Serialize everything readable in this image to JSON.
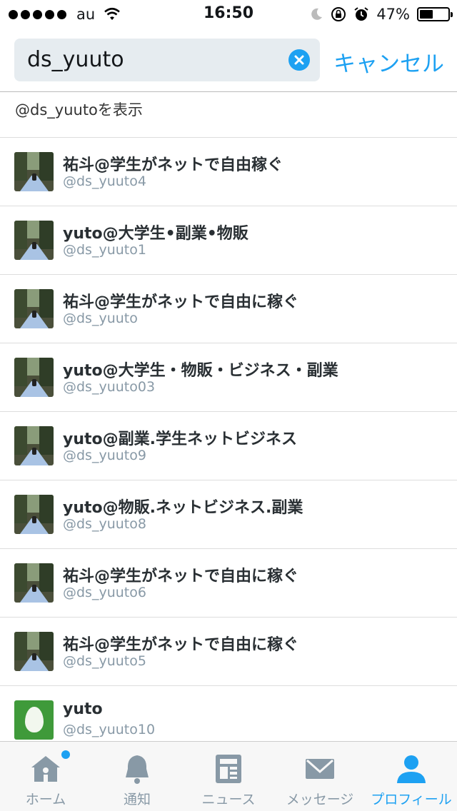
{
  "status_bar": {
    "carrier": "au",
    "time": "16:50",
    "battery_percent_label": "47%",
    "battery_level": 0.47
  },
  "search": {
    "query": "ds_yuuto",
    "cancel_label": "キャンセル",
    "show_handle_label": "@ds_yuutoを表示",
    "accent_color": "#1da1f2"
  },
  "results": [
    {
      "name": "祐斗@学生がネットで自由稼ぐ",
      "handle": "@ds_yuuto4",
      "avatar": "photo"
    },
    {
      "name": "yuto@大学生•副業•物販",
      "handle": "@ds_yuuto1",
      "avatar": "photo"
    },
    {
      "name": "祐斗@学生がネットで自由に稼ぐ",
      "handle": "@ds_yuuto",
      "avatar": "photo"
    },
    {
      "name": "yuto@大学生・物販・ビジネス・副業",
      "handle": "@ds_yuuto03",
      "avatar": "photo"
    },
    {
      "name": "yuto@副業.学生ネットビジネス",
      "handle": "@ds_yuuto9",
      "avatar": "photo"
    },
    {
      "name": "yuto@物販.ネットビジネス.副業",
      "handle": "@ds_yuuto8",
      "avatar": "photo"
    },
    {
      "name": "祐斗@学生がネットで自由に稼ぐ",
      "handle": "@ds_yuuto6",
      "avatar": "photo"
    },
    {
      "name": "祐斗@学生がネットで自由に稼ぐ",
      "handle": "@ds_yuuto5",
      "avatar": "photo"
    },
    {
      "name": "yuto",
      "handle": "@ds_yuuto10",
      "avatar": "egg"
    }
  ],
  "tab_bar": {
    "tabs": [
      {
        "label": "ホーム",
        "icon": "home-icon",
        "active": false
      },
      {
        "label": "通知",
        "icon": "bell-icon",
        "active": false
      },
      {
        "label": "ニュース",
        "icon": "news-icon",
        "active": false
      },
      {
        "label": "メッセージ",
        "icon": "envelope-icon",
        "active": false
      },
      {
        "label": "プロフィール",
        "icon": "person-icon",
        "active": true
      }
    ]
  }
}
